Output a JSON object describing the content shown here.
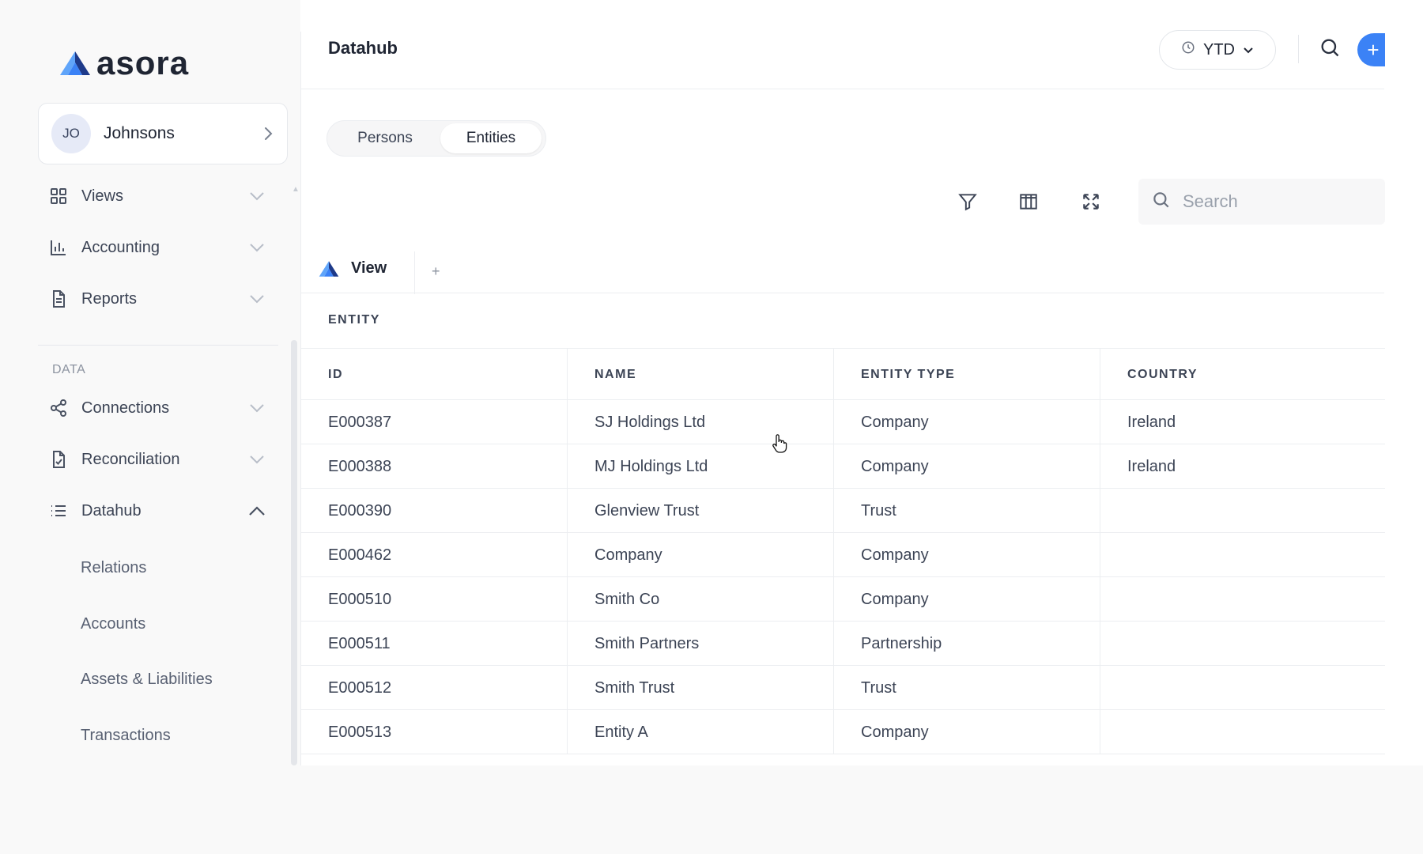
{
  "brand": {
    "name": "asora"
  },
  "org": {
    "initials": "JO",
    "name": "Johnsons"
  },
  "sidebar": {
    "items": [
      {
        "label": "Views",
        "icon": "grid-icon"
      },
      {
        "label": "Accounting",
        "icon": "bar-chart-icon"
      },
      {
        "label": "Reports",
        "icon": "document-icon"
      }
    ],
    "section_label": "DATA",
    "data_items": [
      {
        "label": "Connections",
        "icon": "share-icon"
      },
      {
        "label": "Reconciliation",
        "icon": "file-check-icon"
      },
      {
        "label": "Datahub",
        "icon": "list-icon",
        "expanded": true
      }
    ],
    "datahub_children": [
      "Relations",
      "Accounts",
      "Assets & Liabilities",
      "Transactions"
    ]
  },
  "header": {
    "title": "Datahub",
    "period": "YTD"
  },
  "segments": {
    "persons": "Persons",
    "entities": "Entities",
    "active": "Entities"
  },
  "search": {
    "placeholder": "Search",
    "value": ""
  },
  "view_tabs": {
    "active_label": "View",
    "add_label": "+"
  },
  "table": {
    "caption": "ENTITY",
    "columns": [
      "ID",
      "NAME",
      "ENTITY TYPE",
      "COUNTRY"
    ],
    "rows": [
      [
        "E000387",
        "SJ Holdings Ltd",
        "Company",
        "Ireland"
      ],
      [
        "E000388",
        "MJ Holdings Ltd",
        "Company",
        "Ireland"
      ],
      [
        "E000390",
        "Glenview Trust",
        "Trust",
        ""
      ],
      [
        "E000462",
        "Company",
        "Company",
        ""
      ],
      [
        "E000510",
        "Smith Co",
        "Company",
        ""
      ],
      [
        "E000511",
        "Smith Partners",
        "Partnership",
        ""
      ],
      [
        "E000512",
        "Smith Trust",
        "Trust",
        ""
      ],
      [
        "E000513",
        "Entity A",
        "Company",
        ""
      ]
    ]
  },
  "colors": {
    "accent": "#3b82f6",
    "logo_dark": "#1e3a8a",
    "logo_light": "#60a5fa"
  }
}
